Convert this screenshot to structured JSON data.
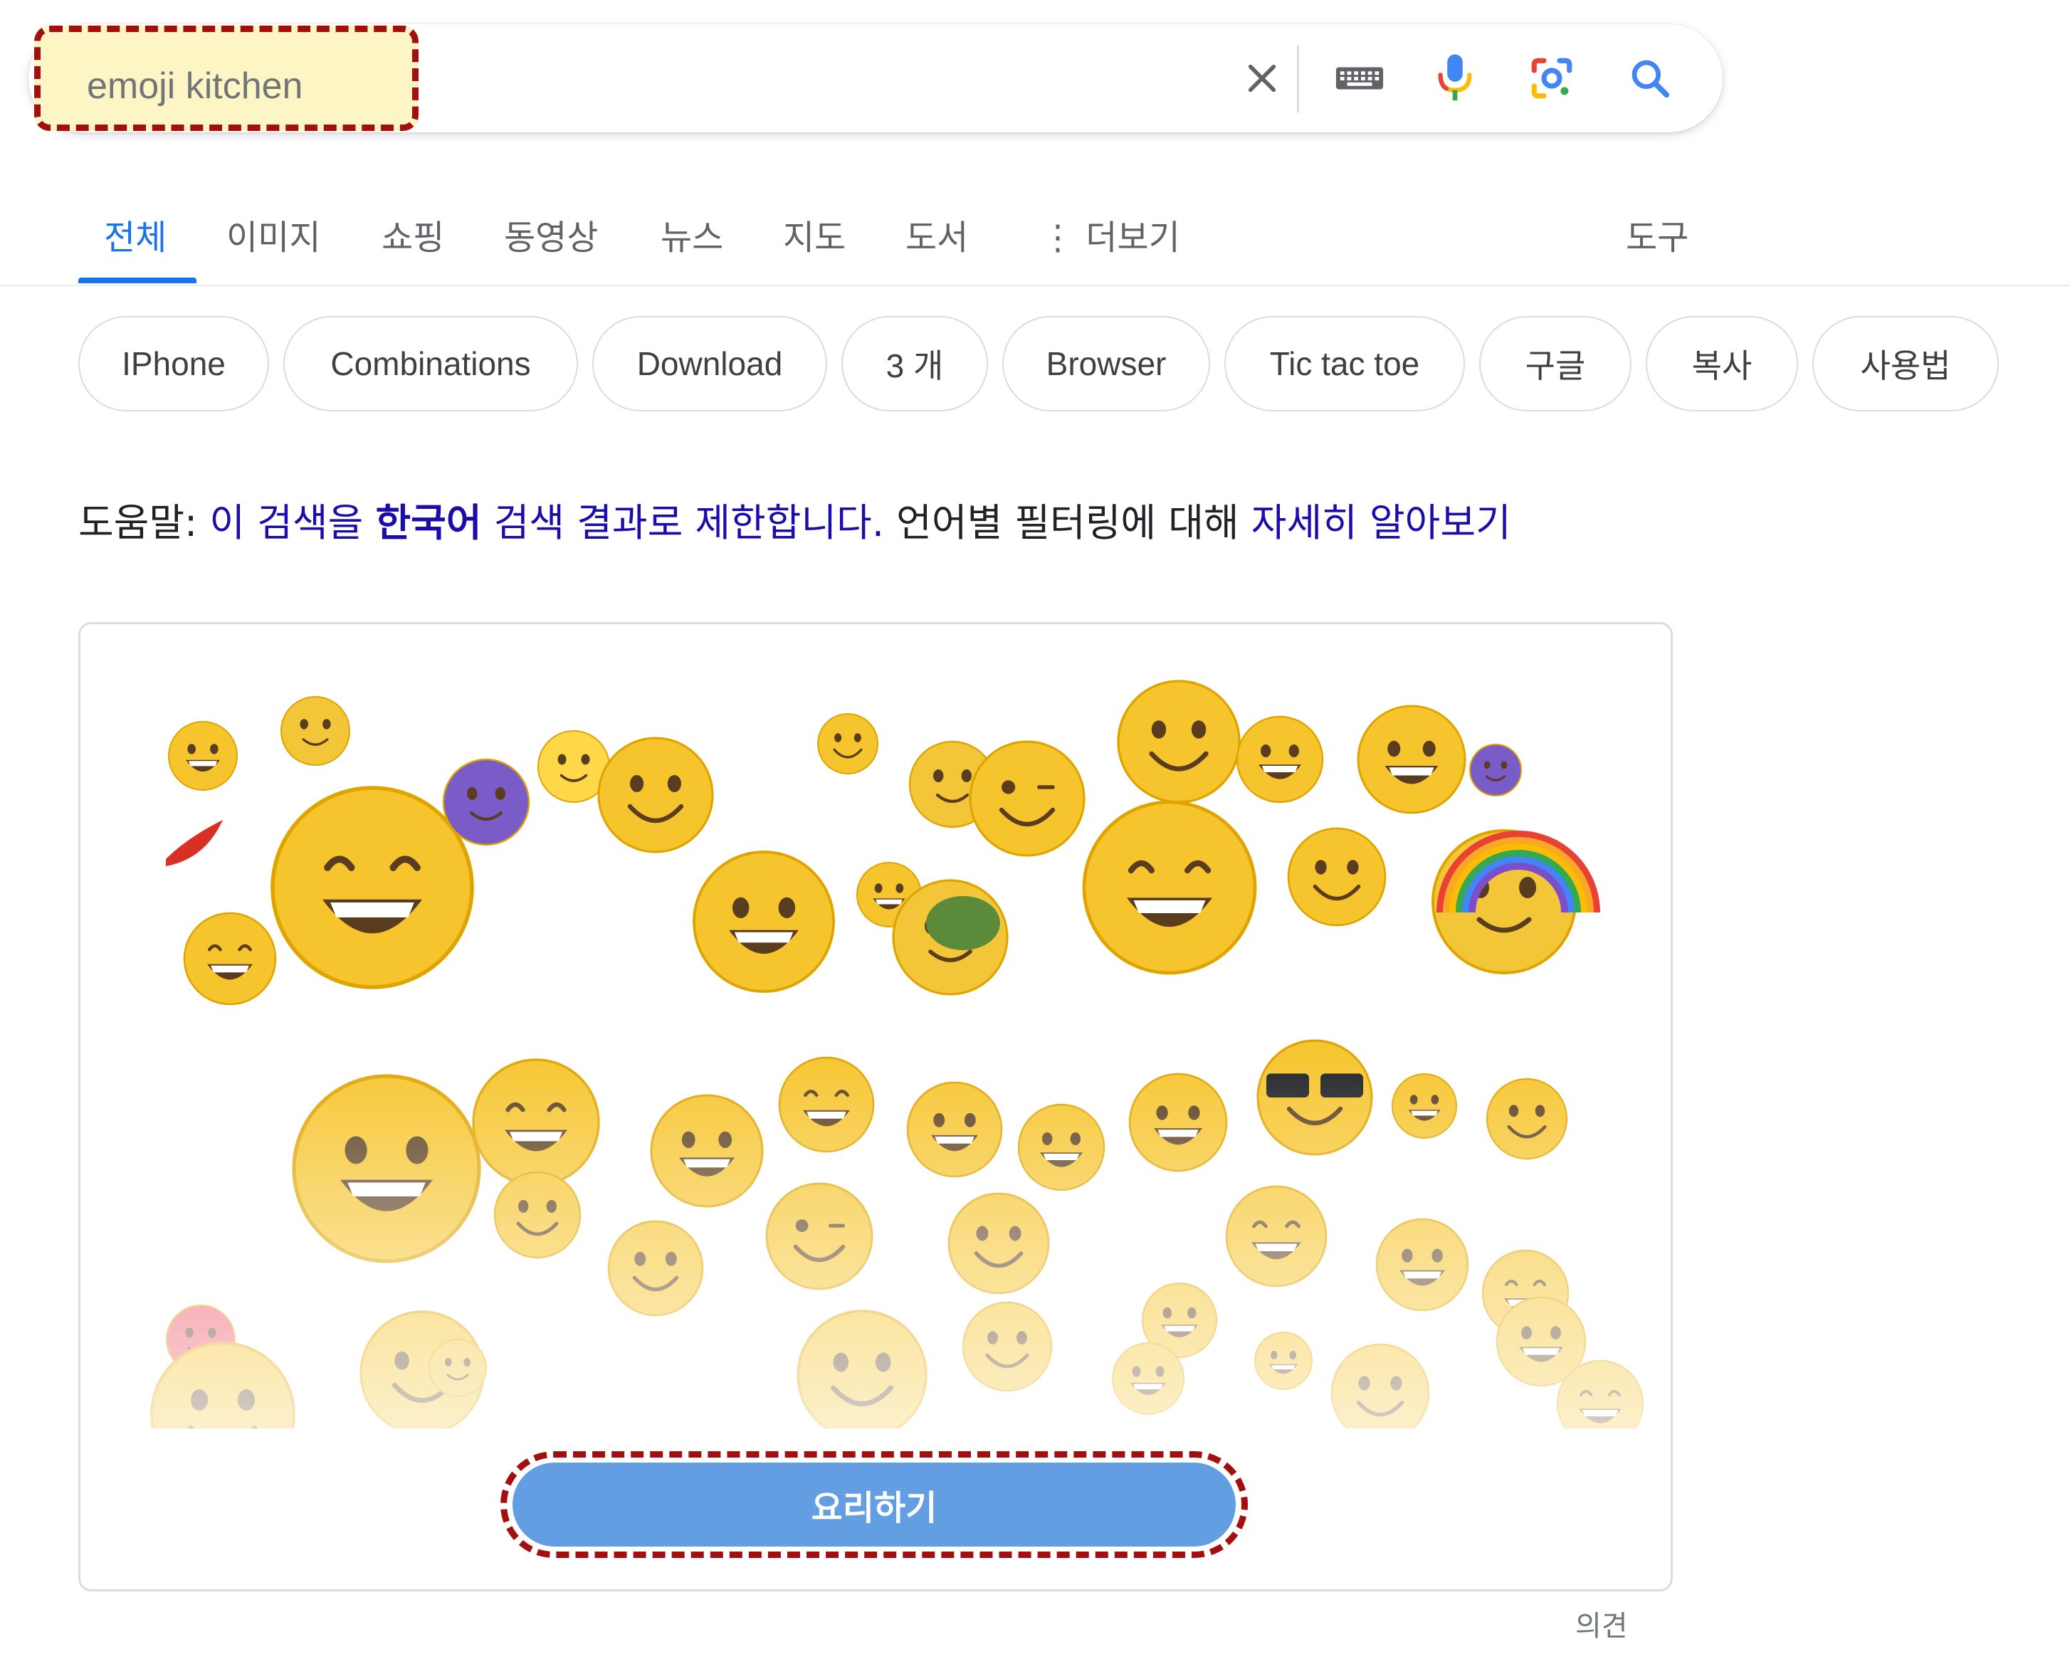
{
  "search": {
    "query": "emoji kitchen",
    "icons": [
      "close-icon",
      "keyboard-icon",
      "mic-icon",
      "lens-icon",
      "search-icon"
    ]
  },
  "tabs": {
    "items": [
      {
        "label": "전체",
        "active": true
      },
      {
        "label": "이미지"
      },
      {
        "label": "쇼핑"
      },
      {
        "label": "동영상"
      },
      {
        "label": "뉴스"
      },
      {
        "label": "지도"
      },
      {
        "label": "도서"
      },
      {
        "label": "⋮ 더보기"
      }
    ],
    "tools": "도구"
  },
  "chips": [
    "IPhone",
    "Combinations",
    "Download",
    "3 개",
    "Browser",
    "Tic tac toe",
    "구글",
    "복사",
    "사용법"
  ],
  "help": {
    "prefix": "도움말:",
    "link1": "이 검색을",
    "bold": "한국어",
    "link2": "검색 결과로 제한합니다.",
    "middle": "언어별 필터링에 대해",
    "link3": "자세히 알아보기"
  },
  "emoji_kitchen": {
    "cook_label": "요리하기",
    "feedback": "의견"
  },
  "colors": {
    "accent": "#1a73e8",
    "link": "#1a0dab",
    "cook_button": "#639ee3",
    "highlight_border": "#a30f0f",
    "query_highlight": "#fdf6c4",
    "emoji_yellow": "#f6c52e"
  }
}
